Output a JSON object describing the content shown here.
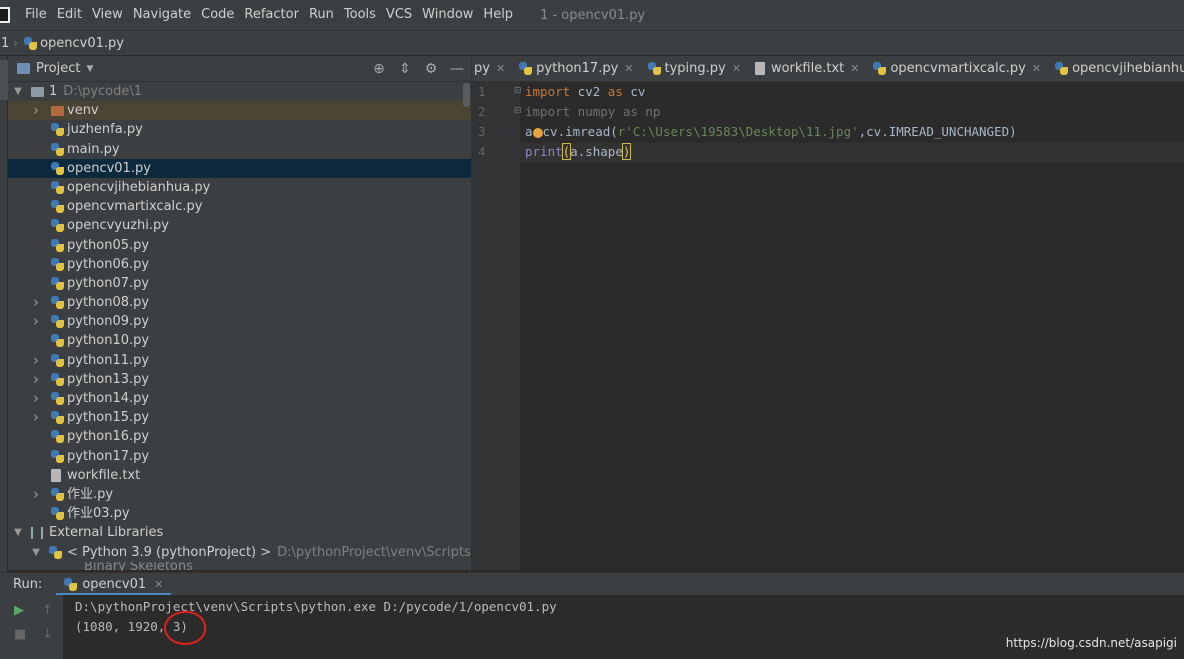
{
  "menubar": {
    "items": [
      "File",
      "Edit",
      "View",
      "Navigate",
      "Code",
      "Refactor",
      "Run",
      "Tools",
      "VCS",
      "Window",
      "Help"
    ],
    "window_title": "1 - opencv01.py"
  },
  "navbar": {
    "root": "1",
    "file": "opencv01.py"
  },
  "project": {
    "title": "Project",
    "root_name": "1",
    "root_path": "D:\\pycode\\1",
    "items": [
      {
        "label": "venv",
        "kind": "folder",
        "expandable": true
      },
      {
        "label": "juzhenfa.py",
        "kind": "py",
        "expandable": false
      },
      {
        "label": "main.py",
        "kind": "py",
        "expandable": false
      },
      {
        "label": "opencv01.py",
        "kind": "py",
        "expandable": false,
        "selected": true
      },
      {
        "label": "opencvjihebianhua.py",
        "kind": "py",
        "expandable": false
      },
      {
        "label": "opencvmartixcalc.py",
        "kind": "py",
        "expandable": false
      },
      {
        "label": "opencvyuzhi.py",
        "kind": "py",
        "expandable": false
      },
      {
        "label": "python05.py",
        "kind": "py",
        "expandable": false
      },
      {
        "label": "python06.py",
        "kind": "py",
        "expandable": false
      },
      {
        "label": "python07.py",
        "kind": "py",
        "expandable": false
      },
      {
        "label": "python08.py",
        "kind": "py",
        "expandable": true
      },
      {
        "label": "python09.py",
        "kind": "py",
        "expandable": true
      },
      {
        "label": "python10.py",
        "kind": "py",
        "expandable": false
      },
      {
        "label": "python11.py",
        "kind": "py",
        "expandable": true
      },
      {
        "label": "python13.py",
        "kind": "py",
        "expandable": true
      },
      {
        "label": "python14.py",
        "kind": "py",
        "expandable": true
      },
      {
        "label": "python15.py",
        "kind": "py",
        "expandable": true
      },
      {
        "label": "python16.py",
        "kind": "py",
        "expandable": false
      },
      {
        "label": "python17.py",
        "kind": "py",
        "expandable": false
      },
      {
        "label": "workfile.txt",
        "kind": "txt",
        "expandable": false
      },
      {
        "label": "作业.py",
        "kind": "py",
        "expandable": true
      },
      {
        "label": "作业03.py",
        "kind": "py",
        "expandable": false
      }
    ],
    "external_libraries": "External Libraries",
    "python_sdk": "< Python 3.9 (pythonProject) >",
    "python_sdk_path": "D:\\pythonProject\\venv\\Scripts\\python.exe",
    "binary_skeletons": "Binary Skeletons"
  },
  "editor": {
    "tabs": [
      {
        "label": "py",
        "icon": false
      },
      {
        "label": "python17.py",
        "icon": true
      },
      {
        "label": "typing.py",
        "icon": true
      },
      {
        "label": "workfile.txt",
        "icon": "txt"
      },
      {
        "label": "opencvmartixcalc.py",
        "icon": true
      },
      {
        "label": "opencvjihebianhua.py",
        "icon": true
      }
    ],
    "line_numbers": [
      "1",
      "2",
      "3",
      "4"
    ],
    "code": {
      "l1_kw1": "import",
      "l1_mid": " cv2 ",
      "l1_kw2": "as",
      "l1_end": " cv",
      "l2": "import numpy as np",
      "l3_a": "a",
      "l3_b": "cv.imread(",
      "l3_str": "r'C:\\Users\\19583\\Desktop\\11.jpg'",
      "l3_c": ",cv.IMREAD_UNCHANGED)",
      "l4_fn": "print",
      "l4_open": "(",
      "l4_mid": "a.shape",
      "l4_close": ")"
    }
  },
  "run": {
    "label": "Run:",
    "tab": "opencv01",
    "console_line1": "D:\\pythonProject\\venv\\Scripts\\python.exe D:/pycode/1/opencv01.py",
    "console_line2": "(1080, 1920, 3)"
  },
  "watermark": "https://blog.csdn.net/asapigi",
  "colors": {
    "selection": "#0d293e",
    "accent": "#4a88c7",
    "keyword": "#cc7832",
    "string": "#6a8759",
    "annotation": "#e2201c"
  }
}
